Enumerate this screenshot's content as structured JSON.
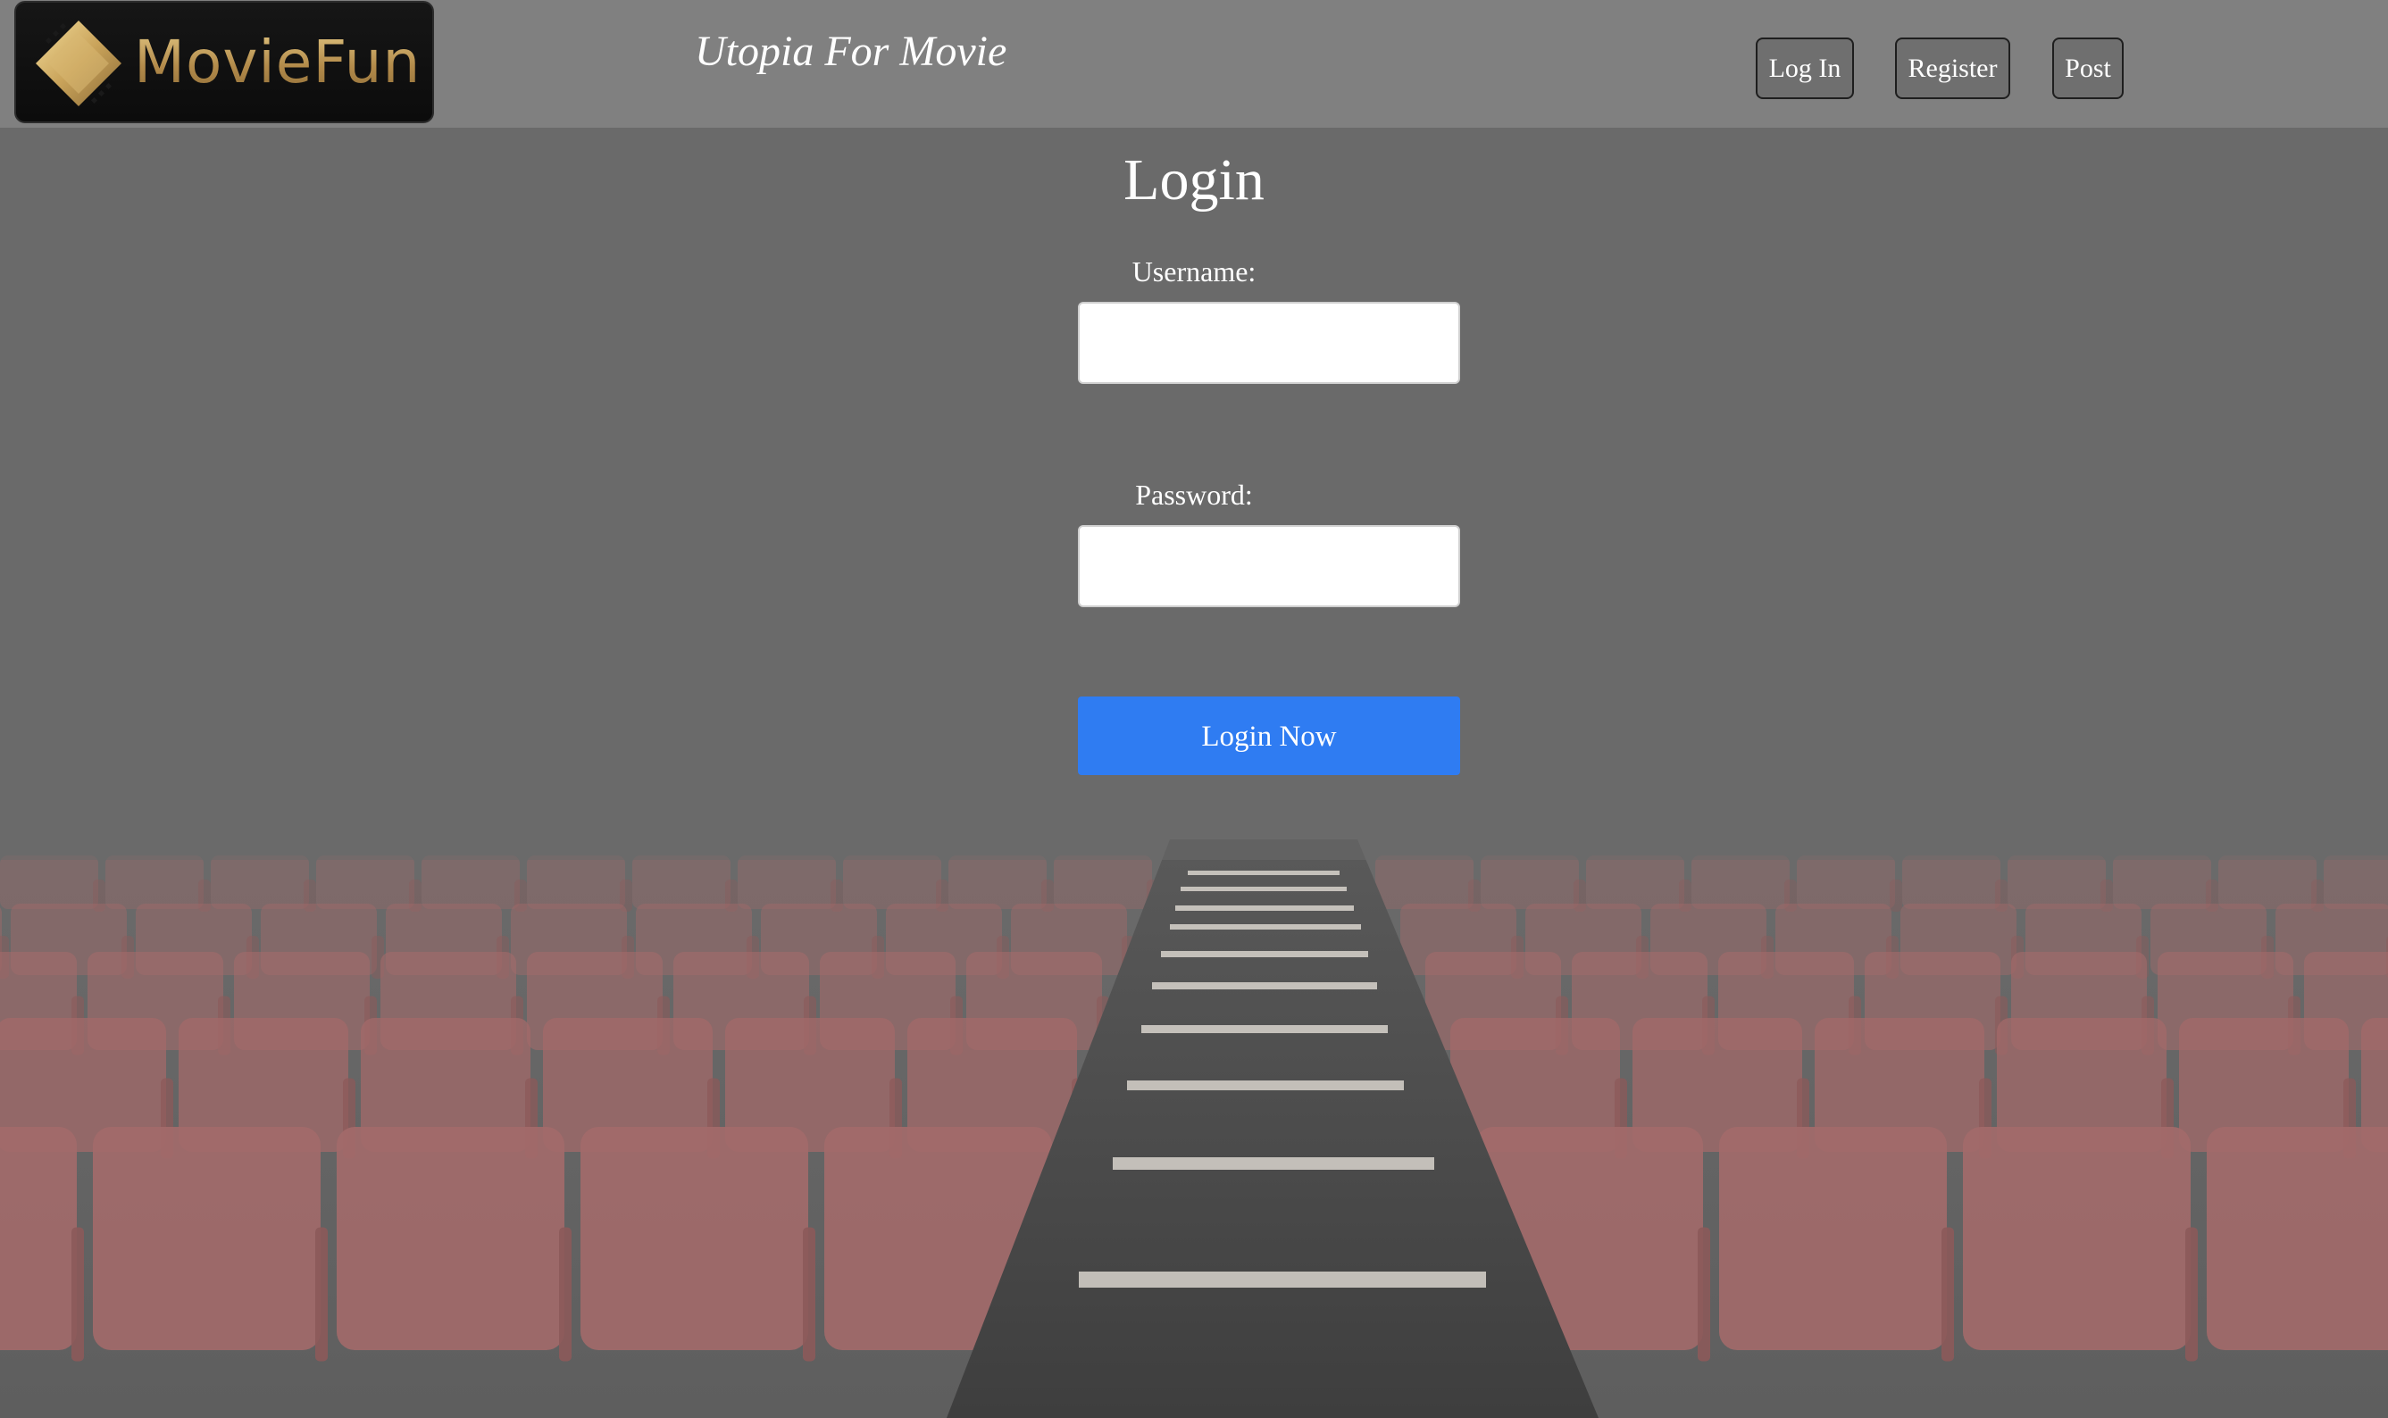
{
  "header": {
    "logo_text": "MovieFun",
    "tagline": "Utopia For Movie",
    "nav": {
      "login_label": "Log In",
      "register_label": "Register",
      "post_label": "Post"
    }
  },
  "login_form": {
    "title": "Login",
    "username_label": "Username:",
    "username_value": "",
    "password_label": "Password:",
    "password_value": "",
    "submit_label": "Login Now"
  },
  "colors": {
    "header_bg": "#808080",
    "page_overlay": "#6a6a6a",
    "submit_button": "#2f7cf2",
    "logo_gold": "#c9a35a",
    "seat_red": "#a36a6a"
  },
  "icons": {
    "logo_mark": "film-strip-diamond-icon"
  }
}
